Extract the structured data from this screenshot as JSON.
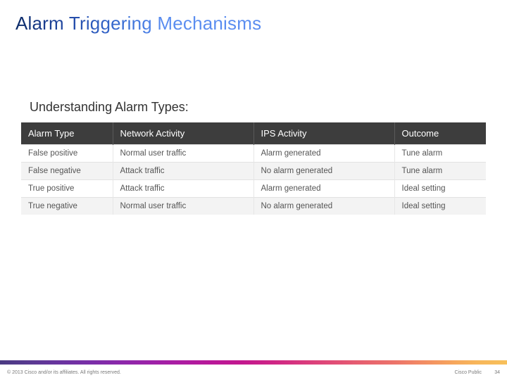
{
  "title": "Alarm Triggering Mechanisms",
  "subtitle": "Understanding Alarm Types:",
  "table": {
    "headers": [
      "Alarm Type",
      "Network Activity",
      "IPS Activity",
      "Outcome"
    ],
    "rows": [
      [
        "False positive",
        "Normal user traffic",
        "Alarm generated",
        "Tune alarm"
      ],
      [
        "False negative",
        "Attack traffic",
        "No alarm generated",
        "Tune alarm"
      ],
      [
        "True positive",
        "Attack traffic",
        "Alarm generated",
        "Ideal setting"
      ],
      [
        "True negative",
        "Normal user traffic",
        "No alarm generated",
        "Ideal setting"
      ]
    ]
  },
  "footer": {
    "copyright": "© 2013 Cisco and/or its affiliates. All rights reserved.",
    "classification": "Cisco Public",
    "page": "34"
  }
}
